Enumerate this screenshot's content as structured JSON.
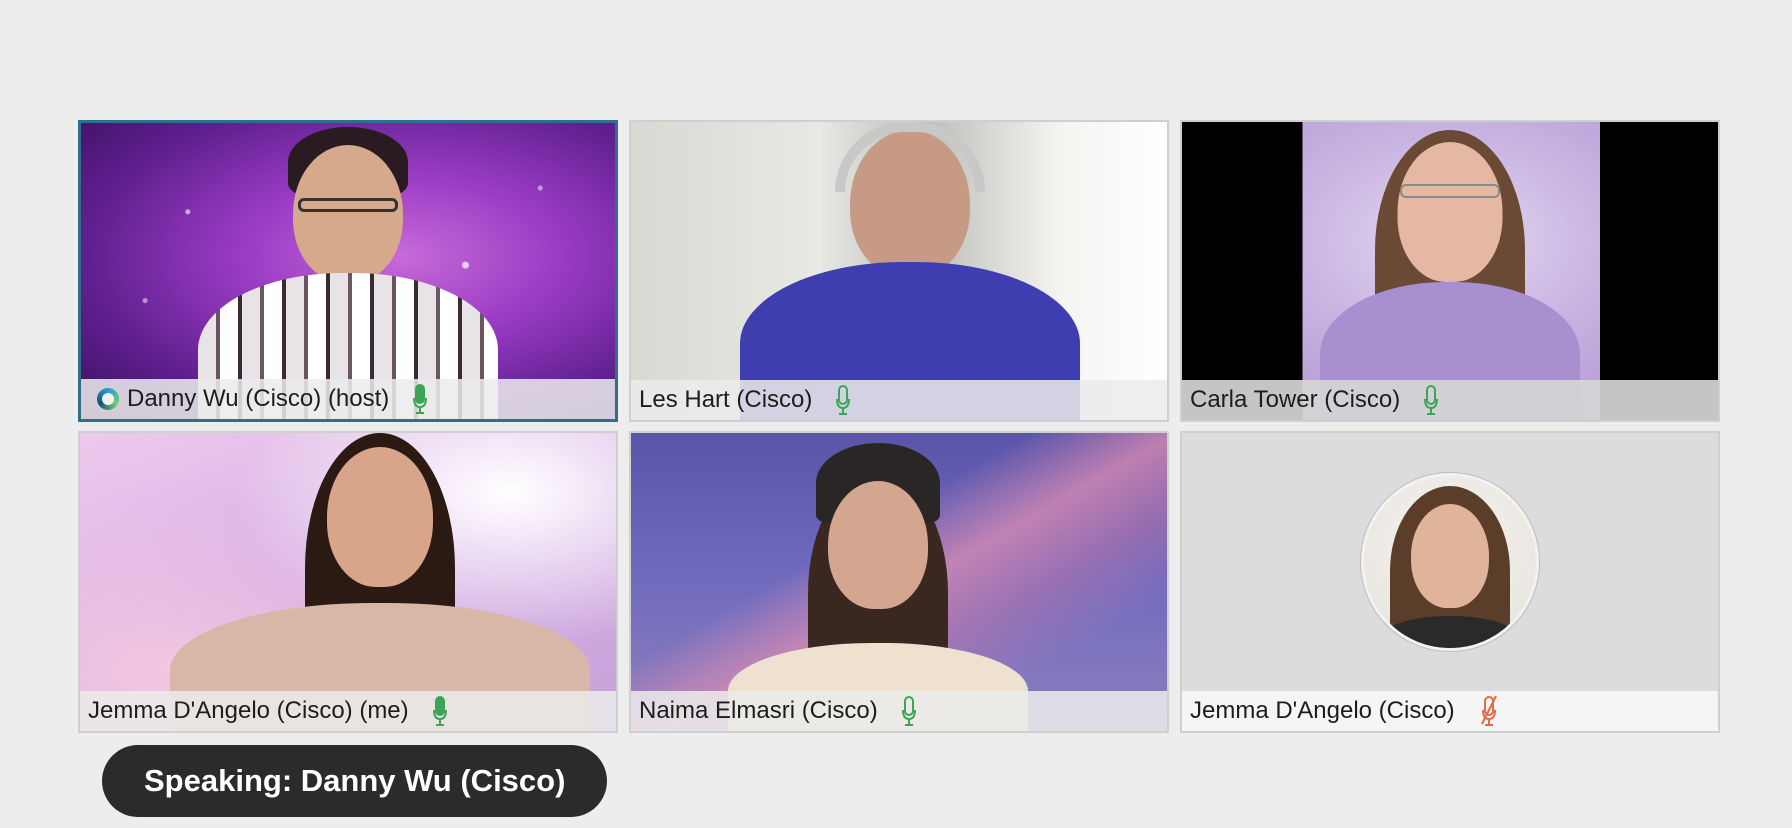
{
  "meeting": {
    "participants": [
      {
        "name": "Danny Wu (Cisco) (host)",
        "mic": "active",
        "host": true
      },
      {
        "name": "Les Hart (Cisco)",
        "mic": "on"
      },
      {
        "name": "Carla Tower (Cisco)",
        "mic": "on"
      },
      {
        "name": "Jemma D'Angelo (Cisco) (me)",
        "mic": "active"
      },
      {
        "name": "Naima Elmasri (Cisco)",
        "mic": "on"
      },
      {
        "name": "Jemma D'Angelo (Cisco)",
        "mic": "muted"
      }
    ],
    "speaking_label": "Speaking: Danny Wu (Cisco)"
  },
  "colors": {
    "mic_on": "#3aa655",
    "mic_muted": "#e06a4a",
    "active_border": "#2f6f8a"
  },
  "icons": {
    "host": "host-badge-icon",
    "mic": "microphone-icon",
    "mic_muted": "microphone-muted-icon"
  }
}
